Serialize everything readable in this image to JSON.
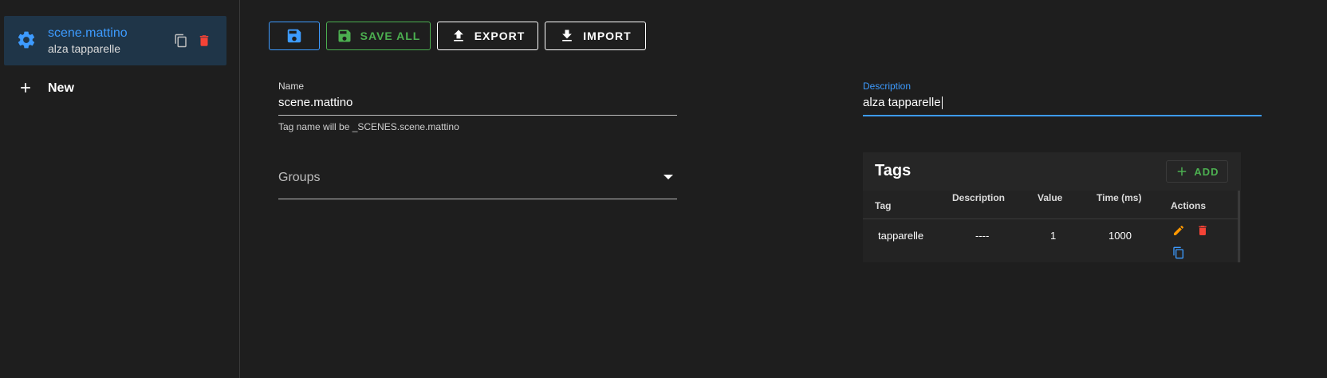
{
  "sidebar": {
    "scene": {
      "name": "scene.mattino",
      "description": "alza tapparelle"
    },
    "new_label": "New"
  },
  "toolbar": {
    "save_all_label": "SAVE ALL",
    "export_label": "EXPORT",
    "import_label": "IMPORT"
  },
  "form": {
    "name_label": "Name",
    "name_value": "scene.mattino",
    "name_hint": "Tag name will be _SCENES.scene.mattino",
    "description_label": "Description",
    "description_value": "alza tapparelle",
    "groups_label": "Groups"
  },
  "tags": {
    "title": "Tags",
    "add_label": "ADD",
    "columns": [
      "Tag",
      "Description",
      "Value",
      "Time (ms)",
      "Actions"
    ],
    "rows": [
      {
        "tag": "tapparelle",
        "description": "----",
        "value": "1",
        "time": "1000"
      }
    ]
  },
  "colors": {
    "background": "#1e1e1e",
    "accent_blue": "#3d9bff",
    "green": "#4caf50",
    "red": "#f44336",
    "orange": "#ff9800",
    "selected_bg": "#1f3548"
  }
}
